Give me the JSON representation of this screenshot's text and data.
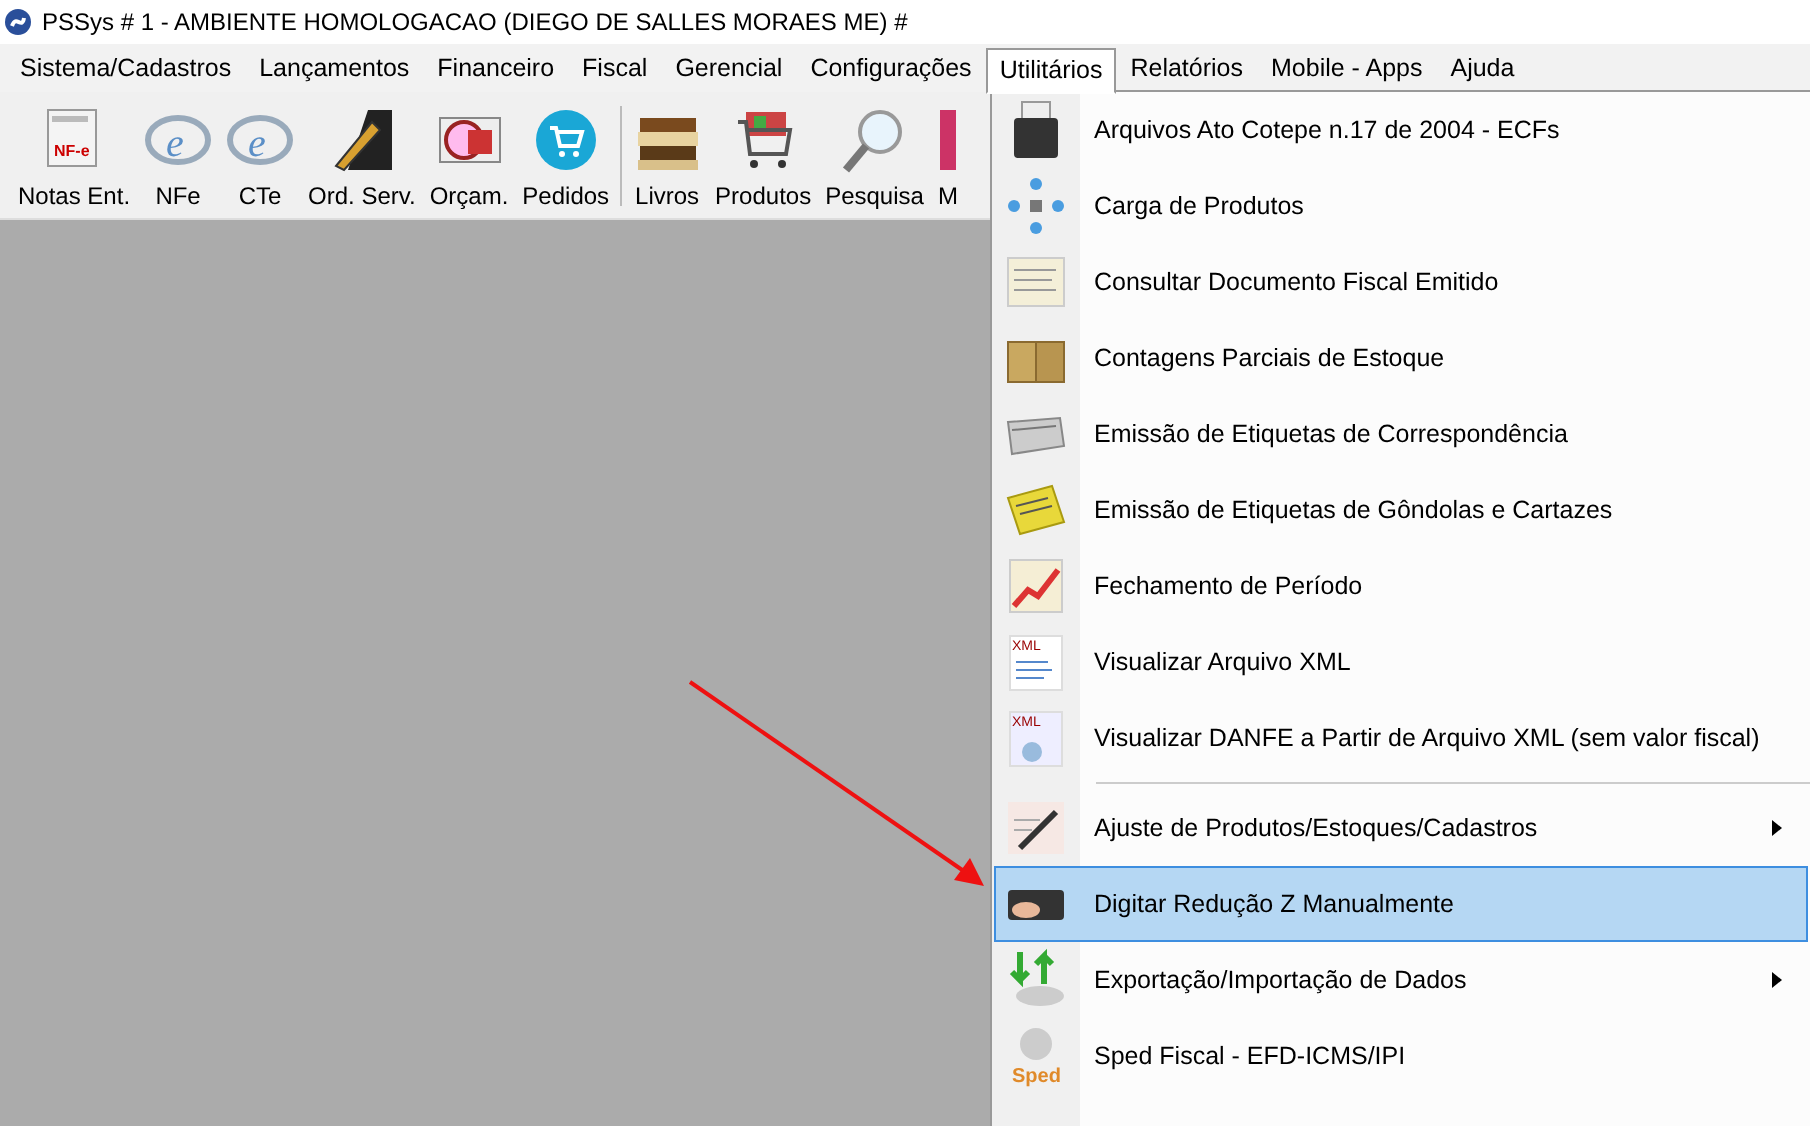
{
  "window": {
    "title": "PSSys # 1 - AMBIENTE HOMOLOGACAO (DIEGO DE SALLES MORAES ME) #"
  },
  "menu_bar": [
    {
      "label": "Sistema/Cadastros",
      "selected": false
    },
    {
      "label": "Lançamentos",
      "selected": false
    },
    {
      "label": "Financeiro",
      "selected": false
    },
    {
      "label": "Fiscal",
      "selected": false
    },
    {
      "label": "Gerencial",
      "selected": false
    },
    {
      "label": "Configurações",
      "selected": false
    },
    {
      "label": "Utilitários",
      "selected": true
    },
    {
      "label": "Relatórios",
      "selected": false
    },
    {
      "label": "Mobile - Apps",
      "selected": false
    },
    {
      "label": "Ajuda",
      "selected": false
    }
  ],
  "toolbar": [
    {
      "label": "Notas Ent.",
      "icon_text": "NF-e"
    },
    {
      "label": "NFe",
      "icon_text": "e"
    },
    {
      "label": "CTe",
      "icon_text": "e"
    },
    {
      "label": "Ord. Serv."
    },
    {
      "label": "Orçam."
    },
    {
      "label": "Pedidos"
    },
    {
      "kind": "separator"
    },
    {
      "label": "Livros"
    },
    {
      "label": "Produtos"
    },
    {
      "label": "Pesquisa"
    },
    {
      "label": "M"
    }
  ],
  "dropdown": [
    {
      "kind": "item",
      "label": "Arquivos Ato Cotepe n.17 de 2004 - ECFs",
      "selected": false,
      "submenu": false
    },
    {
      "kind": "item",
      "label": "Carga de Produtos",
      "selected": false,
      "submenu": false
    },
    {
      "kind": "item",
      "label": "Consultar Documento Fiscal Emitido",
      "selected": false,
      "submenu": false
    },
    {
      "kind": "item",
      "label": "Contagens Parciais de Estoque",
      "selected": false,
      "submenu": false
    },
    {
      "kind": "item",
      "label": "Emissão de Etiquetas de Correspondência",
      "selected": false,
      "submenu": false
    },
    {
      "kind": "item",
      "label": "Emissão de Etiquetas de Gôndolas e Cartazes",
      "selected": false,
      "submenu": false
    },
    {
      "kind": "item",
      "label": "Fechamento de Período",
      "selected": false,
      "submenu": false
    },
    {
      "kind": "item",
      "label": "Visualizar Arquivo XML",
      "icon_text": "XML",
      "selected": false,
      "submenu": false
    },
    {
      "kind": "item",
      "label": "Visualizar DANFE a Partir de Arquivo XML (sem valor fiscal)",
      "icon_text": "XML",
      "selected": false,
      "submenu": false
    },
    {
      "kind": "separator"
    },
    {
      "kind": "item",
      "label": "Ajuste de Produtos/Estoques/Cadastros",
      "selected": false,
      "submenu": true
    },
    {
      "kind": "item",
      "label": "Digitar Redução Z Manualmente",
      "selected": true,
      "submenu": false
    },
    {
      "kind": "item",
      "label": "Exportação/Importação de Dados",
      "selected": false,
      "submenu": true
    },
    {
      "kind": "item",
      "label": "Sped Fiscal - EFD-ICMS/IPI",
      "icon_text": "Sped",
      "selected": false,
      "submenu": false
    }
  ]
}
